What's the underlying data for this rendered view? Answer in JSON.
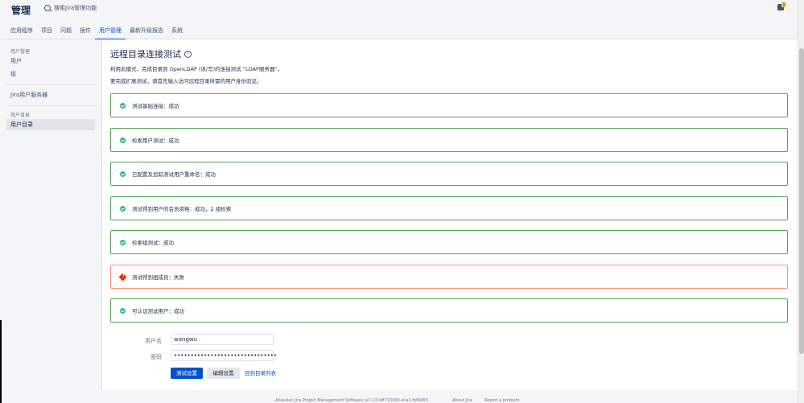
{
  "header": {
    "title": "管理",
    "search_placeholder": "搜索Jira管理功能",
    "notification_count": "1"
  },
  "tabs": [
    {
      "label": "应用程序"
    },
    {
      "label": "项目"
    },
    {
      "label": "问题"
    },
    {
      "label": "插件"
    },
    {
      "label": "用户管理",
      "active": true
    },
    {
      "label": "最新升级报告"
    },
    {
      "label": "系统"
    }
  ],
  "sidebar": {
    "section1_heading": "用户管理",
    "item_users": "用户",
    "item_groups": "组",
    "item_jira_user_server": "Jira用户服务器",
    "section2_heading": "用户目录",
    "item_user_directories": "用户目录"
  },
  "main": {
    "title": "远程目录连接测试",
    "description_1": "利用此模式，完成目录到 OpenLDAP (读/写)的连接测试 “LDAP服务器”。",
    "description_2": "要完成扩展测试，请首先输入访问远程目录所需的用户身份验证。",
    "results": [
      {
        "text": "测试基础连接：成功",
        "status": "success"
      },
      {
        "text": "检索用户测试：成功",
        "status": "success"
      },
      {
        "text": "已配置及追踪测试用户重命名：成功",
        "status": "success"
      },
      {
        "text": "测试得到用户的会员资格：成功，2 组检索",
        "status": "success"
      },
      {
        "text": "检索组测试：成功",
        "status": "success"
      },
      {
        "text": "测试得到组成员：失败",
        "status": "fail"
      },
      {
        "text": "可认证测试用户：成功",
        "status": "success"
      }
    ],
    "form": {
      "username_label": "用户名",
      "username_value": "wangwu",
      "password_label": "密码",
      "password_value": "•••••••••••••••••••••••••••••••"
    },
    "buttons": {
      "test": "测试设置",
      "edit": "编辑设置",
      "back_link": "回到目录列表"
    }
  },
  "footer": {
    "version": "Atlassian Jira Project Management Software (v7.13.0#713000-sha1:fbf406f)",
    "about": "About Jira",
    "report": "Report a problem"
  },
  "colors": {
    "accent": "#0052cc",
    "success": "#36b37e",
    "success_border": "#57a55a",
    "error": "#de350b",
    "error_border": "#ff8f73"
  }
}
